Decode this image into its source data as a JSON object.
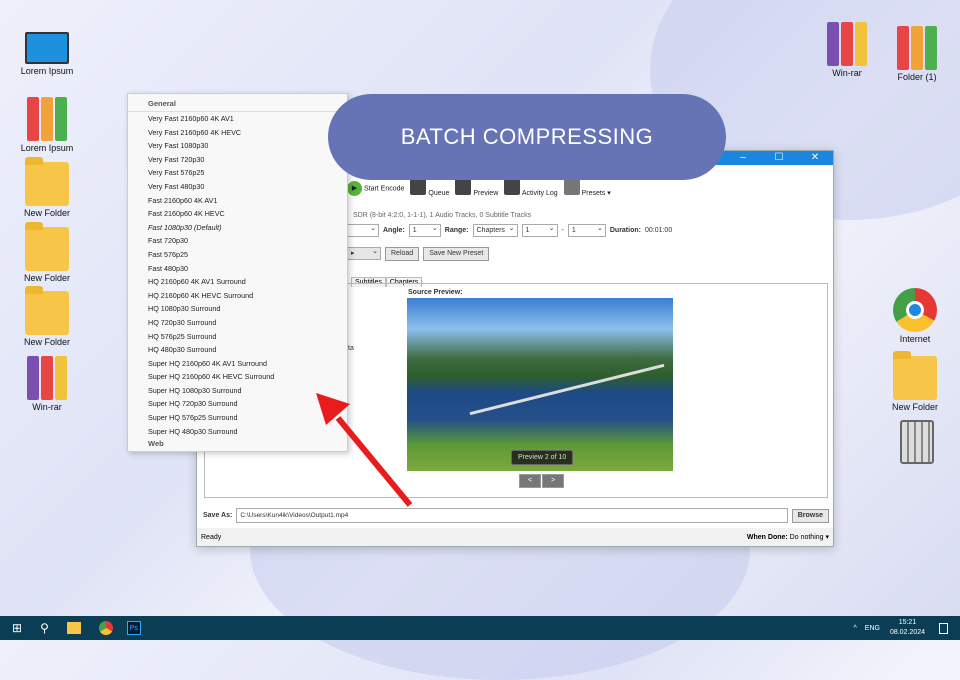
{
  "banner": "BATCH COMPRESSING",
  "desktop_left": [
    {
      "label": "Lorem Ipsum",
      "icon": "computer-icon"
    },
    {
      "label": "Lorem Ipsum",
      "icon": "binders-icon"
    },
    {
      "label": "New Folder",
      "icon": "folder-icon"
    },
    {
      "label": "New Folder",
      "icon": "folder-icon"
    },
    {
      "label": "New Folder",
      "icon": "folder-icon"
    },
    {
      "label": "Win-rar",
      "icon": "winrar-icon"
    }
  ],
  "desktop_right": [
    {
      "label": "Win-rar"
    },
    {
      "label": "Folder (1)"
    },
    {
      "label": "Internet"
    },
    {
      "label": "New Folder"
    }
  ],
  "toolbar": {
    "start_encode": "Start Encode",
    "queue": "Queue",
    "preview": "Preview",
    "activity_log": "Activity Log",
    "presets": "Presets"
  },
  "source_info": "SDR (8-bit 4:2:0, 1-1-1), 1 Audio Tracks, 0 Subtitle Tracks",
  "source_row": {
    "angle_label": "Angle:",
    "angle": "1",
    "range_label": "Range:",
    "range": "Chapters",
    "from": "1",
    "dash": "-",
    "to": "1",
    "duration_label": "Duration:",
    "duration": "00:01:00"
  },
  "preset_row": {
    "reload": "Reload",
    "save_new_preset": "Save New Preset"
  },
  "tabs": [
    "Subtitles",
    "Chapters"
  ],
  "partial_text": "ta",
  "source_preview": {
    "label": "Source Preview:",
    "counter": "Preview 2 of 10",
    "prev": "<",
    "next": ">"
  },
  "save_as": {
    "label": "Save As:",
    "value": "C:\\Users\\Kun4ik\\Videos\\Output1.mp4",
    "browse": "Browse"
  },
  "status": {
    "text": "Ready",
    "when_done_label": "When Done:",
    "when_done": "Do nothing"
  },
  "dropdown": {
    "header": "General",
    "items": [
      "Very Fast 2160p60 4K AV1",
      "Very Fast 2160p60 4K HEVC",
      "Very Fast 1080p30",
      "Very Fast 720p30",
      "Very Fast 576p25",
      "Very Fast 480p30",
      "Fast 2160p60 4K AV1",
      "Fast 2160p60 4K HEVC",
      "Fast 1080p30 (Default)",
      "Fast 720p30",
      "Fast 576p25",
      "Fast 480p30",
      "HQ 2160p60 4K AV1 Surround",
      "HQ 2160p60 4K HEVC Surround",
      "HQ 1080p30 Surround",
      "HQ 720p30 Surround",
      "HQ 576p25 Surround",
      "HQ 480p30 Surround",
      "Super HQ 2160p60 4K AV1 Surround",
      "Super HQ 2160p60 4K HEVC Surround",
      "Super HQ 1080p30 Surround",
      "Super HQ 720p30 Surround",
      "Super HQ 576p25 Surround",
      "Super HQ 480p30 Surround"
    ],
    "next_header": "Web"
  },
  "taskbar": {
    "lang": "ENG",
    "time": "15:21",
    "date": "08.02.2024"
  }
}
